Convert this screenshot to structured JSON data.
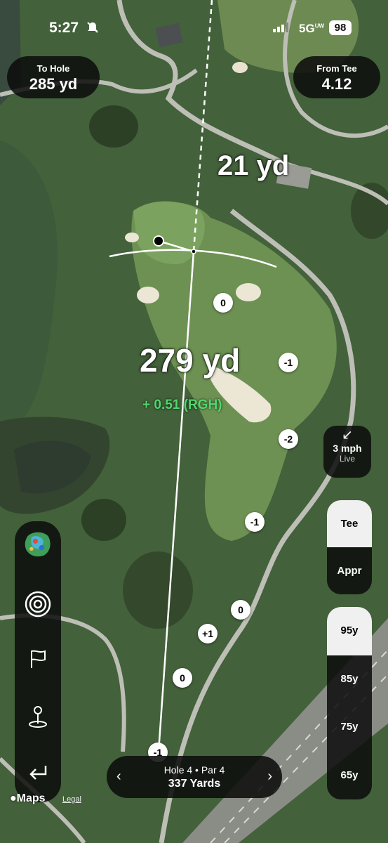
{
  "status_bar": {
    "time": "5:27",
    "network": "5G",
    "network_sup": "UW",
    "battery": "98"
  },
  "to_hole": {
    "label": "To Hole",
    "value": "285 yd"
  },
  "from_tee": {
    "label": "From Tee",
    "value": "4.12"
  },
  "map": {
    "remaining_distance": "21 yd",
    "shot_distance": "279 yd",
    "slope_adjust": "+ 0.51 (RGH)",
    "elevation_badges": [
      "0",
      "-1",
      "-2",
      "-1",
      "0",
      "+1",
      "0",
      "-1"
    ]
  },
  "wind": {
    "icon": "arrow-down-left-icon",
    "speed": "3 mph",
    "status": "Live"
  },
  "tee_toggle": {
    "options": [
      "Tee",
      "Appr"
    ],
    "selected": "Tee"
  },
  "yardage_rings": {
    "options": [
      "95y",
      "85y",
      "75y",
      "65y"
    ],
    "selected": "95y"
  },
  "toolbar": {
    "icons": [
      "green-contour-icon",
      "target-rings-icon",
      "flag-icon",
      "pin-location-icon",
      "back-arrow-icon"
    ]
  },
  "hole_nav": {
    "title": "Hole 4 • Par 4",
    "subtitle": "337 Yards"
  },
  "attribution": {
    "maps": "Maps",
    "legal": "Legal"
  },
  "colors": {
    "accent_green": "#4fd86d",
    "pill_bg": "#0c0c0c"
  }
}
